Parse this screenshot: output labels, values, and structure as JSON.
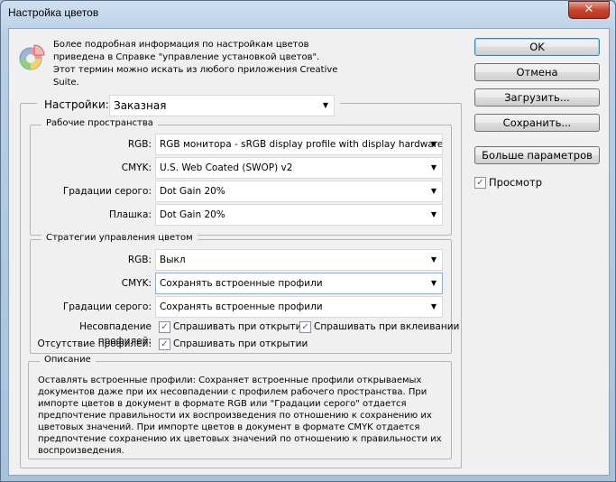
{
  "window": {
    "title": "Настройка цветов",
    "close_icon": "close-icon"
  },
  "info_text": "Более подробная информация по настройкам цветов приведена в Справке \"управление установкой цветов\". Этот термин можно искать из любого приложения Creative Suite.",
  "settings": {
    "label": "Настройки:",
    "value": "Заказная"
  },
  "working_spaces": {
    "title": "Рабочие пространства",
    "rows": [
      {
        "label": "RGB:",
        "value": "RGB монитора - sRGB display profile with display hardware co..."
      },
      {
        "label": "CMYK:",
        "value": "U.S. Web Coated (SWOP) v2"
      },
      {
        "label": "Градации серого:",
        "value": "Dot Gain 20%"
      },
      {
        "label": "Плашка:",
        "value": "Dot Gain 20%"
      }
    ]
  },
  "policies": {
    "title": "Стратегии управления цветом",
    "rows": [
      {
        "label": "RGB:",
        "value": "Выкл"
      },
      {
        "label": "CMYK:",
        "value": "Сохранять встроенные профили"
      },
      {
        "label": "Градации серого:",
        "value": "Сохранять встроенные профили"
      }
    ],
    "mismatch_label": "Несовпадение профилей:",
    "mismatch_open": "Спрашивать при открытии",
    "mismatch_paste": "Спрашивать при вклеивании",
    "missing_label": "Отсутствие профилей:",
    "missing_open": "Спрашивать при открытии"
  },
  "description": {
    "title": "Описание",
    "text": "Оставлять встроенные профили:  Сохраняет встроенные профили открываемых документов даже при их несовпадении с профилем рабочего пространства. При импорте цветов в документ в формате RGB или \"Градации серого\" отдается предпочтение правильности их воспроизведения по отношению к сохранению их цветовых значений. При импорте цветов в документ в формате CMYK отдается предпочтение сохранению их цветовых значений по отношению к правильности их воспроизведения."
  },
  "buttons": {
    "ok": "OK",
    "cancel": "Отмена",
    "load": "Загрузить...",
    "save": "Сохранить...",
    "more": "Больше параметров"
  },
  "preview": {
    "label": "Просмотр",
    "checked": true
  }
}
